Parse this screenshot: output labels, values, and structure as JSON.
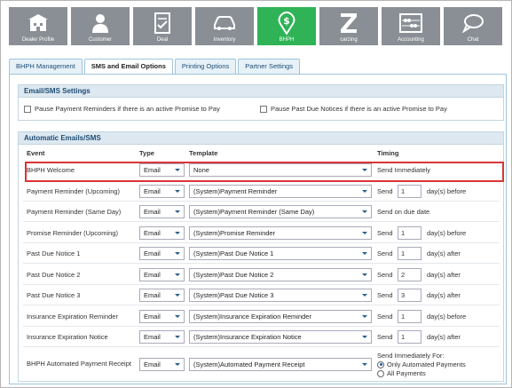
{
  "nav": [
    {
      "label": "Dealer Profile",
      "icon": "building-icon"
    },
    {
      "label": "Customer",
      "icon": "person-icon"
    },
    {
      "label": "Deal",
      "icon": "document-icon"
    },
    {
      "label": "Inventory",
      "icon": "car-icon"
    },
    {
      "label": "BHPH",
      "icon": "dollar-pin-icon"
    },
    {
      "label": "carzing",
      "icon": "carzing-z-icon"
    },
    {
      "label": "Accounting",
      "icon": "abacus-icon"
    },
    {
      "label": "Chat",
      "icon": "chat-bubble-icon"
    }
  ],
  "active_nav": "BHPH",
  "colors": {
    "nav_tile": "#8a8f95",
    "nav_active": "#2fb356",
    "highlight": "#d9353a"
  },
  "tabs": [
    "BHPH Management",
    "SMS and Email Options",
    "Printing Options",
    "Partner Settings"
  ],
  "active_tab": "SMS and Email Options",
  "settings": {
    "title": "Email/SMS Settings",
    "pause_payment": "Pause Payment Reminders if there is an active Promise to Pay",
    "pause_pastdue": "Pause Past Due Notices if there is an active Promise to Pay"
  },
  "auto": {
    "title": "Automatic Emails/SMS",
    "headers": {
      "event": "Event",
      "type": "Type",
      "template": "Template",
      "timing": "Timing"
    },
    "rows": [
      {
        "event": "BHPH Welcome",
        "type": "Email",
        "template": "None",
        "timing": "Send Immediately"
      },
      {
        "event": "Payment Reminder (Upcoming)",
        "type": "Email",
        "template": "(System)Payment Reminder",
        "send": "Send",
        "days": "1",
        "unit": "day(s) before"
      },
      {
        "event": "Payment Reminder (Same Day)",
        "type": "Email",
        "template": "(System)Payment Reminder (Same Day)",
        "timing": "Send on due date"
      },
      {
        "event": "Promise Reminder (Upcoming)",
        "type": "Email",
        "template": "(System)Promise Reminder",
        "send": "Send",
        "days": "1",
        "unit": "day(s) before"
      },
      {
        "event": "Past Due Notice 1",
        "type": "Email",
        "template": "(System)Past Due Notice 1",
        "send": "Send",
        "days": "1",
        "unit": "day(s) after"
      },
      {
        "event": "Past Due Notice 2",
        "type": "Email",
        "template": "(System)Past Due Notice 2",
        "send": "Send",
        "days": "2",
        "unit": "day(s) after"
      },
      {
        "event": "Past Due Notice 3",
        "type": "Email",
        "template": "(System)Past Due Notice 3",
        "send": "Send",
        "days": "3",
        "unit": "day(s) after"
      },
      {
        "event": "Insurance Expiration Reminder",
        "type": "Email",
        "template": "(System)Insurance Expiration Reminder",
        "send": "Send",
        "days": "1",
        "unit": "day(s) before"
      },
      {
        "event": "Insurance Expiration Notice",
        "type": "Email",
        "template": "(System)Insurance Expiration Notice",
        "send": "Send",
        "days": "1",
        "unit": "day(s) after"
      },
      {
        "event": "BHPH Automated Payment Receipt",
        "type": "Email",
        "template": "(System)Automated Payment Receipt",
        "timing_title": "Send Immediately For:",
        "opt1": "Only Automated Payments",
        "opt2": "All Payments"
      }
    ]
  }
}
